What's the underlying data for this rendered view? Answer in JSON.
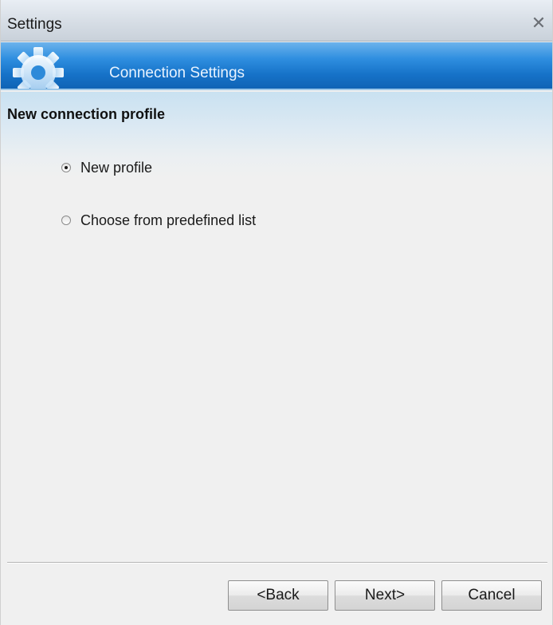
{
  "window": {
    "title": "Settings",
    "close_glyph": "✕"
  },
  "banner": {
    "icon": "gear-icon",
    "title": "Connection Settings"
  },
  "section": {
    "title": "New connection profile"
  },
  "options": [
    {
      "label": "New profile",
      "selected": true
    },
    {
      "label": "Choose from predefined list",
      "selected": false
    }
  ],
  "buttons": {
    "back_label": "<Back",
    "next_label": "Next>",
    "cancel_label": "Cancel"
  },
  "colors": {
    "banner_blue": "#1672c8",
    "background": "#f0f0f0"
  }
}
